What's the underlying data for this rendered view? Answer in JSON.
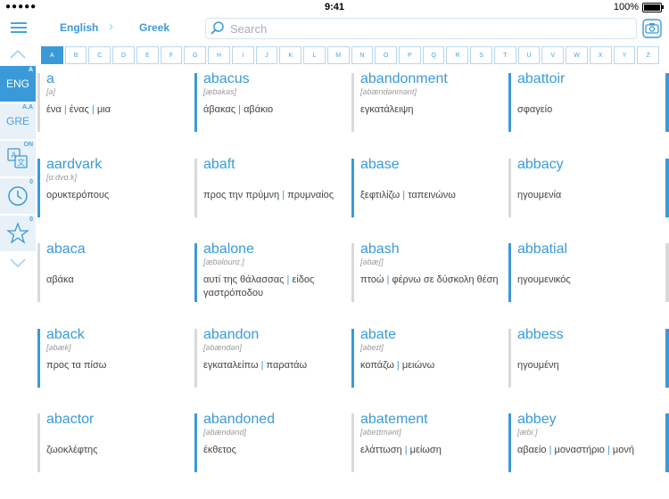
{
  "status": {
    "carrier": "●●●●●",
    "time": "9:41",
    "battery": "100%"
  },
  "header": {
    "from_lang": "English",
    "to_lang": "Greek",
    "search_placeholder": "Search"
  },
  "sidebar": {
    "eng": {
      "label": "ENG",
      "tag": "A"
    },
    "gre": {
      "label": "GRE",
      "tag": "A.A"
    },
    "translate_tag": "ON",
    "history_count": "0",
    "favorites_count": "0"
  },
  "alphabet": [
    "A",
    "B",
    "C",
    "D",
    "E",
    "F",
    "G",
    "H",
    "I",
    "J",
    "K",
    "L",
    "M",
    "N",
    "O",
    "P",
    "Q",
    "R",
    "S",
    "T",
    "U",
    "V",
    "W",
    "X",
    "Y",
    "Z"
  ],
  "active_letter": "A",
  "entries": [
    {
      "word": "a",
      "pron": "[ə]",
      "trans": [
        "ένα",
        "ένας",
        "μια"
      ],
      "bar": "grey"
    },
    {
      "word": "abacus",
      "pron": "[æbəkəs]",
      "trans": [
        "άβακας",
        "αβάκιο"
      ],
      "bar": "blue"
    },
    {
      "word": "abandonment",
      "pron": "[əbændənmənt]",
      "trans": [
        "εγκατάλειψη"
      ],
      "bar": "grey"
    },
    {
      "word": "abattoir",
      "pron": "",
      "trans": [
        "σφαγείο"
      ],
      "bar": "blue"
    },
    {
      "word": "aardvark",
      "pron": "[ɑːdvɑːk]",
      "trans": [
        "ορυκτερόπους"
      ],
      "bar": "blue"
    },
    {
      "word": "abaft",
      "pron": "",
      "trans": [
        "προς την πρύμνη",
        "πρυμναίος"
      ],
      "bar": "grey"
    },
    {
      "word": "abase",
      "pron": "",
      "trans": [
        "ξεφτιλίζω",
        "ταπεινώνω"
      ],
      "bar": "blue"
    },
    {
      "word": "abbacy",
      "pron": "",
      "trans": [
        "ηγουμενία"
      ],
      "bar": "grey"
    },
    {
      "word": "abaca",
      "pron": "",
      "trans": [
        "αβάκα"
      ],
      "bar": "grey"
    },
    {
      "word": "abalone",
      "pron": "[æbəlounɪː]",
      "trans": [
        "αυτί της θάλασσας",
        "είδος γαστρόποδου"
      ],
      "bar": "blue"
    },
    {
      "word": "abash",
      "pron": "[əbæʃ]",
      "trans": [
        "πτοώ",
        "φέρνω σε δύσκολη θέση"
      ],
      "bar": "grey"
    },
    {
      "word": "abbatial",
      "pron": "",
      "trans": [
        "ηγουμενικός"
      ],
      "bar": "blue"
    },
    {
      "word": "aback",
      "pron": "[əbæk]",
      "trans": [
        "προς τα πίσω"
      ],
      "bar": "blue"
    },
    {
      "word": "abandon",
      "pron": "[əbændən]",
      "trans": [
        "εγκαταλείπω",
        "παρατάω"
      ],
      "bar": "grey"
    },
    {
      "word": "abate",
      "pron": "[əbeɪt]",
      "trans": [
        "κοπάζω",
        "μειώνω"
      ],
      "bar": "blue"
    },
    {
      "word": "abbess",
      "pron": "",
      "trans": [
        "ηγουμένη"
      ],
      "bar": "grey"
    },
    {
      "word": "abactor",
      "pron": "",
      "trans": [
        "ζωοκλέφτης"
      ],
      "bar": "grey"
    },
    {
      "word": "abandoned",
      "pron": "[əbændənd]",
      "trans": [
        "έκθετος"
      ],
      "bar": "blue"
    },
    {
      "word": "abatement",
      "pron": "[əbeɪtmənt]",
      "trans": [
        "ελάττωση",
        "μείωση"
      ],
      "bar": "grey"
    },
    {
      "word": "abbey",
      "pron": "[æbiː]",
      "trans": [
        "αβαείο",
        "μοναστήριο",
        "μονή"
      ],
      "bar": "blue"
    }
  ],
  "edge_bars": [
    "blue",
    "blue",
    "grey",
    "blue",
    "blue"
  ],
  "colors": {
    "accent": "#3a9ad9",
    "inactive_bar": "#d9d9d9",
    "sidebar_bg": "#e9f1f8"
  }
}
